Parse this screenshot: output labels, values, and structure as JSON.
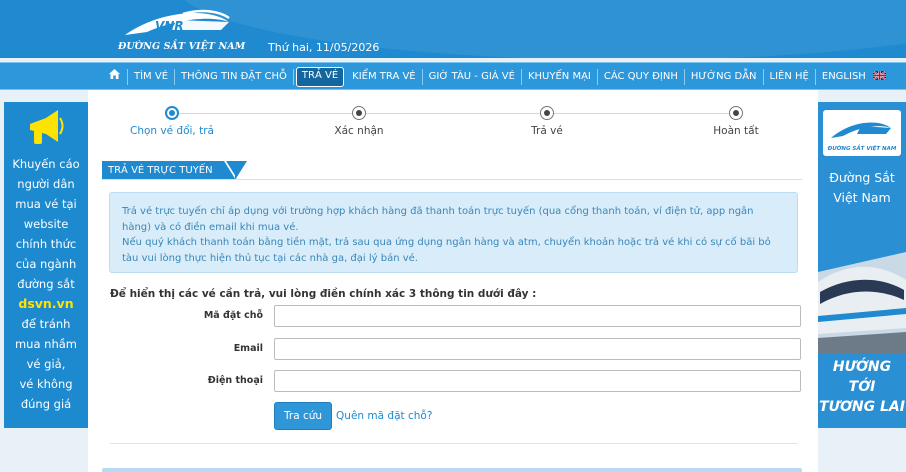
{
  "header": {
    "logo_text": "ĐƯỜNG SẮT VIỆT NAM",
    "logo_mark": "VNR",
    "date": "Thứ hai, 11/05/2026"
  },
  "nav": {
    "home_icon": "home-icon",
    "items": [
      {
        "label": "TÌM VÉ"
      },
      {
        "label": "THÔNG TIN ĐẶT CHỖ"
      },
      {
        "label": "TRẢ VÉ"
      },
      {
        "label": "KIỂM TRA VÉ"
      },
      {
        "label": "GIỜ TÀU - GIÁ VÉ"
      },
      {
        "label": "KHUYẾN MẠI"
      },
      {
        "label": "CÁC QUY ĐỊNH"
      },
      {
        "label": "HƯỚNG DẪN"
      },
      {
        "label": "LIÊN HỆ"
      },
      {
        "label": "ENGLISH"
      }
    ],
    "active": "TRẢ VÉ",
    "language_flag": "uk-flag-icon"
  },
  "left_banner": {
    "lines": [
      "Khuyến cáo",
      "người dân",
      "mua vé tại",
      "website",
      "chính thức",
      "của ngành",
      "đường sắt"
    ],
    "highlight": "dsvn.vn",
    "lines_after": [
      "để tránh",
      "mua nhầm",
      "vé giả,",
      "vé không",
      "đúng giá"
    ],
    "icon": "megaphone-icon"
  },
  "right_banner": {
    "logo_text": "ĐƯỜNG SẮT VIỆT NAM",
    "title_lines": [
      "Đường Sắt",
      "Việt Nam"
    ],
    "slogan_lines": [
      "HƯỚNG TỚI",
      "TƯƠNG LAI"
    ]
  },
  "steps": [
    {
      "label": "Chọn vé đổi, trả",
      "active": true
    },
    {
      "label": "Xác nhận",
      "active": false
    },
    {
      "label": "Trả vé",
      "active": false
    },
    {
      "label": "Hoàn tất",
      "active": false
    }
  ],
  "section": {
    "title": "TRẢ VÉ TRỰC TUYẾN"
  },
  "info": {
    "paragraph1": "Trả vé trực tuyến chỉ áp dụng với trường hợp khách hàng đã thanh toán trực tuyến (qua cổng thanh toán, ví điện tử, app ngân hàng) và có điền email khi mua vé.",
    "paragraph2": "Nếu quý khách thanh toán bằng tiền mặt, trả sau qua ứng dụng ngân hàng và atm, chuyển khoản hoặc trả vé khi có sự cố bãi bỏ tàu vui lòng thực hiện thủ tục tại các nhà ga, đại lý bán vé."
  },
  "form": {
    "prompt": "Để hiển thị các vé cần trả, vui lòng điền chính xác 3 thông tin dưới đây :",
    "booking_code_label": "Mã đặt chỗ",
    "booking_code_value": "",
    "email_label": "Email",
    "email_value": "",
    "phone_label": "Điện thoại",
    "phone_value": "",
    "submit_label": "Tra cứu",
    "forgot_label": "Quên mã đặt chỗ?"
  },
  "colors": {
    "brand_blue": "#1f8ad0",
    "nav_blue": "#2d97dc",
    "info_bg": "#d8ecf9",
    "banner_yellow": "#ffe300"
  }
}
